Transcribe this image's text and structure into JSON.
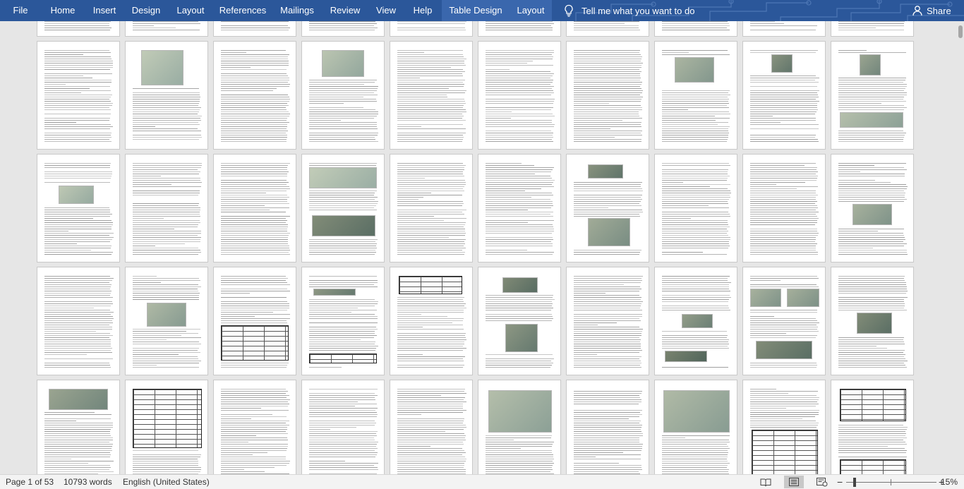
{
  "ribbon": {
    "tabs": [
      {
        "label": "File",
        "name": "tab-file"
      },
      {
        "label": "Home",
        "name": "tab-home"
      },
      {
        "label": "Insert",
        "name": "tab-insert"
      },
      {
        "label": "Design",
        "name": "tab-design"
      },
      {
        "label": "Layout",
        "name": "tab-layout"
      },
      {
        "label": "References",
        "name": "tab-references"
      },
      {
        "label": "Mailings",
        "name": "tab-mailings"
      },
      {
        "label": "Review",
        "name": "tab-review"
      },
      {
        "label": "View",
        "name": "tab-view"
      },
      {
        "label": "Help",
        "name": "tab-help"
      },
      {
        "label": "Table Design",
        "name": "tab-table-design"
      },
      {
        "label": "Layout",
        "name": "tab-table-layout"
      }
    ],
    "tell_me": "Tell me what you want to do",
    "share": "Share",
    "icons": {
      "tell_me": "lightbulb-icon",
      "share": "person-icon"
    }
  },
  "status": {
    "page": "Page 1 of 53",
    "words": "10793 words",
    "language": "English (United States)",
    "zoom": "15%",
    "zoom_percent": 15,
    "views": [
      "read-mode",
      "print-layout",
      "web-layout"
    ],
    "active_view": "print-layout"
  },
  "colors": {
    "ribbon": "#2b579a",
    "ribbon_context_tab": "#3a67ad",
    "doc_background": "#e6e6e6",
    "status_bar": "#f3f3f3"
  }
}
